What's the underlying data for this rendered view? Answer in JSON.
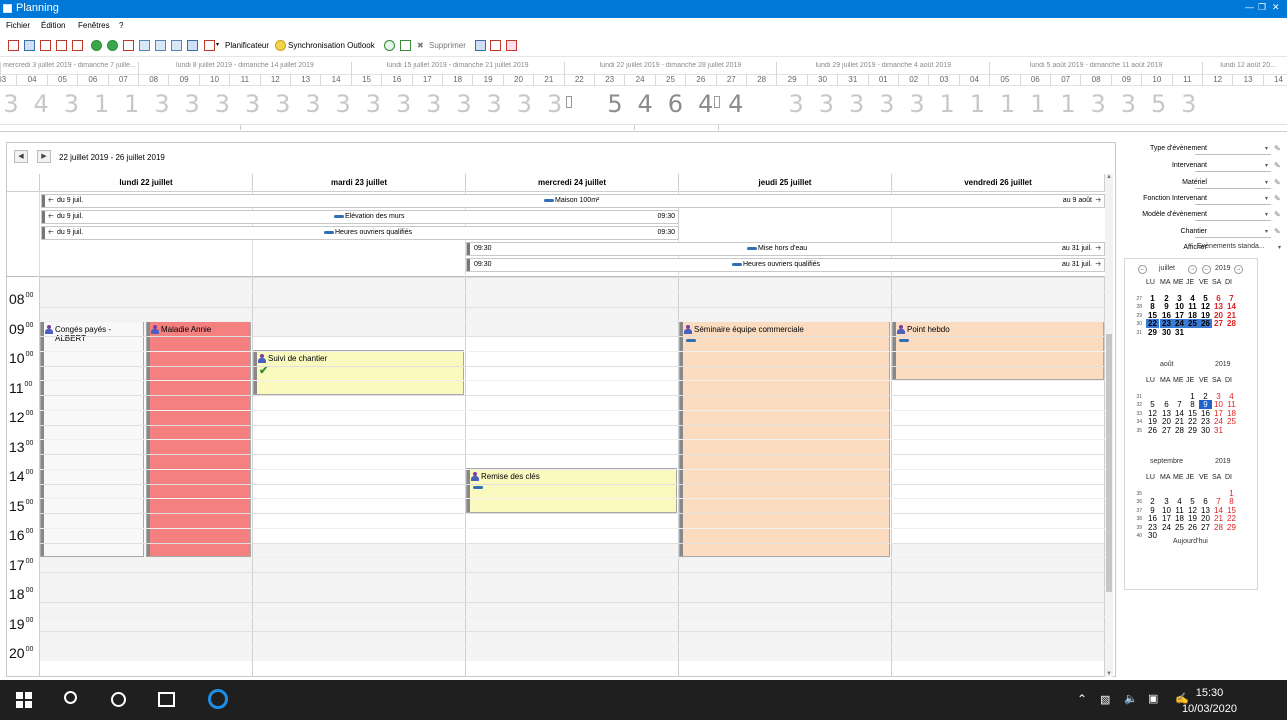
{
  "window": {
    "title": "Planning"
  },
  "menu": {
    "items": [
      "Fichier",
      "Édition",
      "Fenêtres",
      "?"
    ]
  },
  "toolbar": {
    "planificateur": "Planificateur",
    "sync": "Synchronisation Outlook",
    "delete": "Supprimer"
  },
  "timeline": {
    "weeks": [
      "mercredi 3 juillet 2019 - dimanche 7 juille...",
      "lundi 8 juillet 2019 - dimanche 14 juillet 2019",
      "lundi 15 juillet 2019 - dimanche 21 juillet 2019",
      "lundi 22 juillet 2019 - dimanche 28 juillet 2019",
      "lundi 29 juillet 2019 - dimanche 4 août 2019",
      "lundi 5 août 2019 - dimanche 11 août 2019",
      "lundi 12 août 20..."
    ],
    "days": [
      "03",
      "04",
      "05",
      "06",
      "07",
      "08",
      "09",
      "10",
      "11",
      "12",
      "13",
      "14",
      "15",
      "16",
      "17",
      "18",
      "19",
      "20",
      "21",
      "22",
      "23",
      "24",
      "25",
      "26",
      "27",
      "28",
      "29",
      "30",
      "31",
      "01",
      "02",
      "03",
      "04",
      "05",
      "06",
      "07",
      "08",
      "09",
      "10",
      "11",
      "12",
      "13",
      "14"
    ],
    "counts": [
      "3",
      "4",
      "3",
      "1",
      "1",
      "3",
      "3",
      "3",
      "3",
      "3",
      "3",
      "3",
      "3",
      "3",
      "3",
      "3",
      "3",
      "3",
      "3",
      "",
      "5",
      "4",
      "6",
      "4",
      "4",
      "",
      "3",
      "3",
      "3",
      "3",
      "3",
      "1",
      "1",
      "1",
      "1",
      "1",
      "3",
      "3",
      "5",
      "3"
    ]
  },
  "planner": {
    "range": "22 juillet 2019 - 26 juillet 2019",
    "days": [
      "lundi 22 juillet",
      "mardi 23 juillet",
      "mercredi 24 juillet",
      "jeudi 25 juillet",
      "vendredi 26 juillet"
    ],
    "allday": [
      {
        "left": "du 9 juil.",
        "title": "Maison 100m²",
        "right": "au 9 août"
      },
      {
        "left": "du 9 juil.",
        "title": "Elévation des murs",
        "right": "09:30"
      },
      {
        "left": "du 9 juil.",
        "title": "Heures ouvriers qualifiés",
        "right": "09:30"
      },
      {
        "left": "09:30",
        "title": "Mise hors d'eau",
        "right": "au 31 juil."
      },
      {
        "left": "09:30",
        "title": "Heures ouvriers qualifiés",
        "right": "au 31 juil."
      }
    ],
    "hours": [
      "08",
      "09",
      "10",
      "11",
      "12",
      "13",
      "14",
      "15",
      "16",
      "17",
      "18",
      "19",
      "20"
    ],
    "minutes": "00",
    "events": [
      {
        "title": "Congés payés - ALBERT"
      },
      {
        "title": "Maladie Annie"
      },
      {
        "title": "Suivi de chantier"
      },
      {
        "title": "Remise des clés"
      },
      {
        "title": "Séminaire équipe commerciale"
      },
      {
        "title": "Point hebdo"
      }
    ]
  },
  "filters": {
    "rows": [
      {
        "label": "Type d'évènement",
        "value": ""
      },
      {
        "label": "Intervenant",
        "value": ""
      },
      {
        "label": "Matériel",
        "value": ""
      },
      {
        "label": "Fonction Intervenant",
        "value": ""
      },
      {
        "label": "Modèle d'évènement",
        "value": ""
      },
      {
        "label": "Chantier",
        "value": ""
      },
      {
        "label": "Afficher",
        "value": "Evènements standa..."
      }
    ]
  },
  "minical": {
    "dow": [
      "LU",
      "MA",
      "ME",
      "JE",
      "VE",
      "SA",
      "DI"
    ],
    "today_label": "Aujourd'hui",
    "months": [
      {
        "month": "juillet",
        "year": "2019",
        "weeks": [
          "27",
          "28",
          "29",
          "30",
          "31"
        ],
        "rows": [
          [
            "1",
            "2",
            "3",
            "4",
            "5",
            "6",
            "7"
          ],
          [
            "8",
            "9",
            "10",
            "11",
            "12",
            "13",
            "14"
          ],
          [
            "15",
            "16",
            "17",
            "18",
            "19",
            "20",
            "21"
          ],
          [
            "22",
            "23",
            "24",
            "25",
            "26",
            "27",
            "28"
          ],
          [
            "29",
            "30",
            "31",
            "",
            "",
            "",
            ""
          ]
        ]
      },
      {
        "month": "août",
        "year": "2019",
        "weeks": [
          "31",
          "32",
          "33",
          "34",
          "35"
        ],
        "rows": [
          [
            "",
            "",
            "",
            "1",
            "2",
            "3",
            "4"
          ],
          [
            "5",
            "6",
            "7",
            "8",
            "9",
            "10",
            "11"
          ],
          [
            "12",
            "13",
            "14",
            "15",
            "16",
            "17",
            "18"
          ],
          [
            "19",
            "20",
            "21",
            "22",
            "23",
            "24",
            "25"
          ],
          [
            "26",
            "27",
            "28",
            "29",
            "30",
            "31",
            ""
          ]
        ]
      },
      {
        "month": "septembre",
        "year": "2019",
        "weeks": [
          "35",
          "36",
          "37",
          "38",
          "39",
          "40"
        ],
        "rows": [
          [
            "",
            "",
            "",
            "",
            "",
            "",
            "1"
          ],
          [
            "2",
            "3",
            "4",
            "5",
            "6",
            "7",
            "8"
          ],
          [
            "9",
            "10",
            "11",
            "12",
            "13",
            "14",
            "15"
          ],
          [
            "16",
            "17",
            "18",
            "19",
            "20",
            "21",
            "22"
          ],
          [
            "23",
            "24",
            "25",
            "26",
            "27",
            "28",
            "29"
          ],
          [
            "30",
            "",
            "",
            "",
            "",
            "",
            ""
          ]
        ]
      }
    ]
  },
  "taskbar": {
    "time": "15:30",
    "date": "10/03/2020"
  },
  "colors": {
    "accent": "#0078d7",
    "sick": "#f48080",
    "yellow": "#fafac0",
    "orange": "#fbdcc0",
    "leave": "#f8f8f8"
  }
}
